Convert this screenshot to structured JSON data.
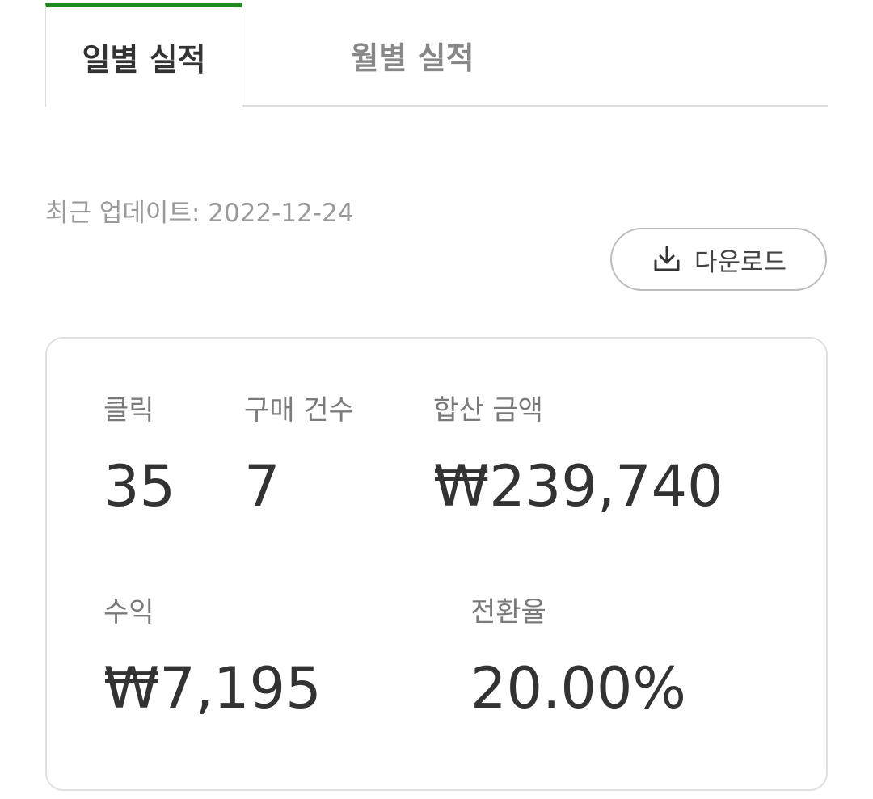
{
  "tabs": [
    {
      "label": "일별 실적",
      "active": true
    },
    {
      "label": "월별 실적",
      "active": false
    }
  ],
  "last_update": "최근 업데이트: 2022-12-24",
  "download": {
    "label": "다운로드",
    "icon": "download-icon"
  },
  "stats": {
    "clicks": {
      "label": "클릭",
      "value": "35"
    },
    "purchases": {
      "label": "구매 건수",
      "value": "7"
    },
    "total_amount": {
      "label": "합산 금액",
      "value": "₩239,740"
    },
    "revenue": {
      "label": "수익",
      "value": "₩7,195"
    },
    "conversion": {
      "label": "전환율",
      "value": "20.00%"
    }
  },
  "colors": {
    "accent": "#1d8a1d",
    "text": "#333333",
    "muted": "#9a9a9a",
    "border": "#e0e0e0"
  }
}
